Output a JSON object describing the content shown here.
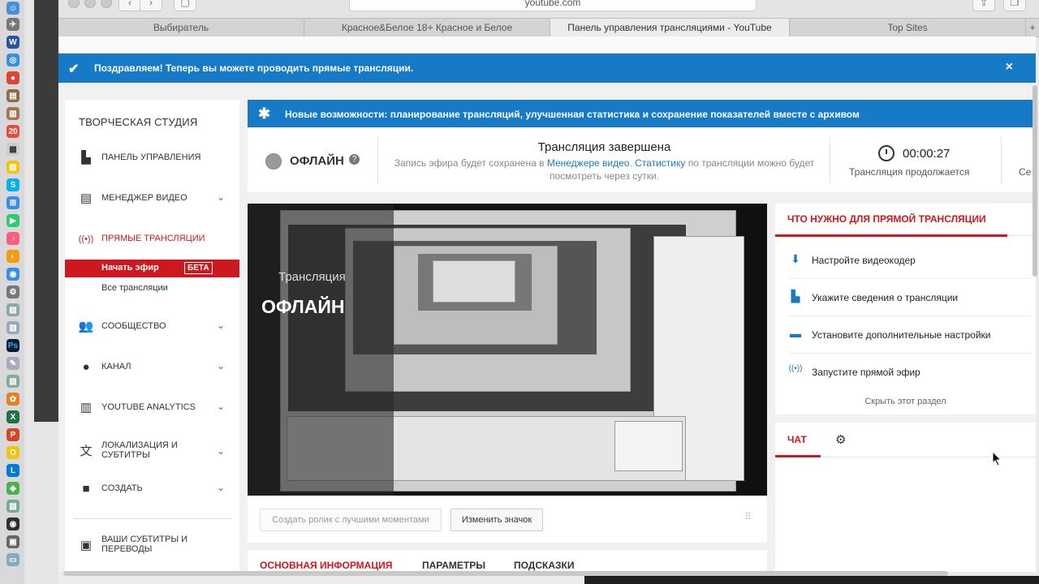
{
  "browser": {
    "url": "youtube.com",
    "tabs": [
      "Выбиратель",
      "Красное&Белое 18+ Красное и Белое",
      "Панель управления трансляциями - YouTube",
      "Top Sites"
    ],
    "active_tab": 2
  },
  "banner": {
    "text": "Поздравляем! Теперь вы можете проводить прямые трансляции.",
    "close": "×"
  },
  "sidebar": {
    "title": "ТВОРЧЕСКАЯ СТУДИЯ",
    "items": [
      {
        "label": "Панель управления",
        "icon": "dashboard-icon"
      },
      {
        "label": "Менеджер видео",
        "icon": "video-manager-icon"
      },
      {
        "label": "Прямые трансляции",
        "icon": "live-icon"
      },
      {
        "label": "Сообщество",
        "icon": "people-icon"
      },
      {
        "label": "Канал",
        "icon": "user-icon"
      },
      {
        "label": "YouTube Analytics",
        "icon": "analytics-icon"
      },
      {
        "label": "Локализация и субтитры",
        "icon": "translate-icon"
      },
      {
        "label": "Создать",
        "icon": "camera-icon"
      },
      {
        "label": "Ваши субтитры и переводы",
        "icon": "subtitles-icon"
      }
    ],
    "start_stream": "Начать эфир",
    "beta": "БЕТА",
    "all_streams": "Все трансляции"
  },
  "new_features": "Новые возможности: планирование трансляций, улучшенная статистика и сохранение показателей вместе с архивом",
  "status": {
    "offline": "ОФЛАЙН",
    "ended_title": "Трансляция завершена",
    "desc_before": "Запись эфира будет сохранена в ",
    "desc_link1": "Менеджере видео",
    "desc_mid": ". ",
    "desc_link2": "Статистику",
    "desc_after": " по трансляции можно будет посмотреть через сутки.",
    "timer": "00:00:27",
    "timer_label": "Трансляция продолжается",
    "extra_label": "Се"
  },
  "video": {
    "overlay_label": "Трансляция",
    "overlay_big": "ОФЛАЙН",
    "btn_highlight": "Создать ролик с лучшими моментами",
    "btn_thumb": "Изменить значок"
  },
  "bottom_tabs": [
    "ОСНОВНАЯ ИНФОРМАЦИЯ",
    "ПАРАМЕТРЫ",
    "ПОДСКАЗКИ"
  ],
  "requirements": {
    "title": "ЧТО НУЖНО ДЛЯ ПРЯМОЙ ТРАНСЛЯЦИИ",
    "items": [
      {
        "label": "Настройте видеокодер",
        "icon": "download-icon"
      },
      {
        "label": "Укажите сведения о трансляции",
        "icon": "chart-icon"
      },
      {
        "label": "Установите дополнительные настройки",
        "icon": "card-icon"
      },
      {
        "label": "Запустите прямой эфир",
        "icon": "broadcast-icon"
      }
    ],
    "hide": "Скрыть этот раздел"
  },
  "chat": {
    "tab": "ЧАТ"
  },
  "colors": {
    "accent_blue": "#167ac6",
    "accent_red": "#cc181e"
  }
}
